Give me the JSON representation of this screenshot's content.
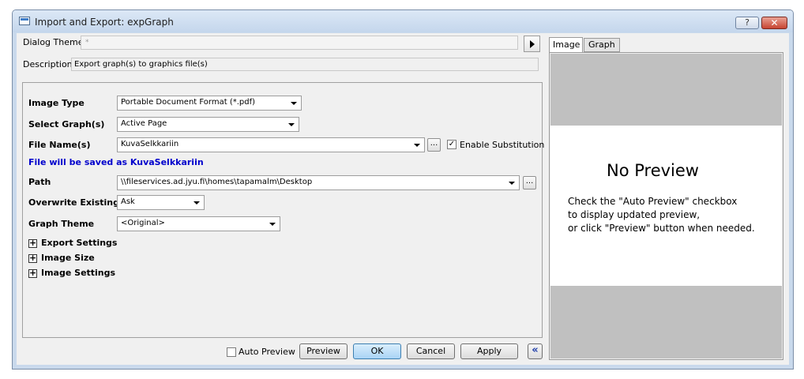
{
  "window": {
    "title": "Import and Export: expGraph",
    "help": "?",
    "close": "✕"
  },
  "dialog_theme": {
    "label": "Dialog Theme",
    "value": "*"
  },
  "description": {
    "label": "Description",
    "value": "Export graph(s) to graphics file(s)"
  },
  "form": {
    "image_type": {
      "label": "Image Type",
      "value": "Portable Document Format (*.pdf)"
    },
    "select_graphs": {
      "label": "Select Graph(s)",
      "value": "Active Page"
    },
    "file_names": {
      "label": "File Name(s)",
      "value": "KuvaSelkkariin",
      "ellipsis": "...",
      "enable_substitution": "Enable Substitution",
      "enable_substitution_checked": true
    },
    "saved_note": "File will be saved as KuvaSelkkariin",
    "path": {
      "label": "Path",
      "value": "\\\\fileservices.ad.jyu.fi\\homes\\tapamalm\\Desktop",
      "ellipsis": "..."
    },
    "overwrite": {
      "label": "Overwrite Existing",
      "value": "Ask"
    },
    "graph_theme": {
      "label": "Graph Theme",
      "value": "<Original>"
    },
    "sections": [
      "Export Settings",
      "Image Size",
      "Image Settings"
    ],
    "expander_glyph": "+"
  },
  "buttons": {
    "auto_preview": "Auto Preview",
    "preview": "Preview",
    "ok": "OK",
    "cancel": "Cancel",
    "apply": "Apply",
    "collapse": "«"
  },
  "preview": {
    "tabs": [
      "Image",
      "Graph"
    ],
    "title": "No Preview",
    "lines": [
      "Check the \"Auto Preview\" checkbox",
      "to display updated preview,",
      "or click \"Preview\" button when needed."
    ]
  },
  "colors": {
    "saved_note": "#0000cc",
    "ok_button": "#a9d3f5",
    "close_button": "#c74432"
  }
}
